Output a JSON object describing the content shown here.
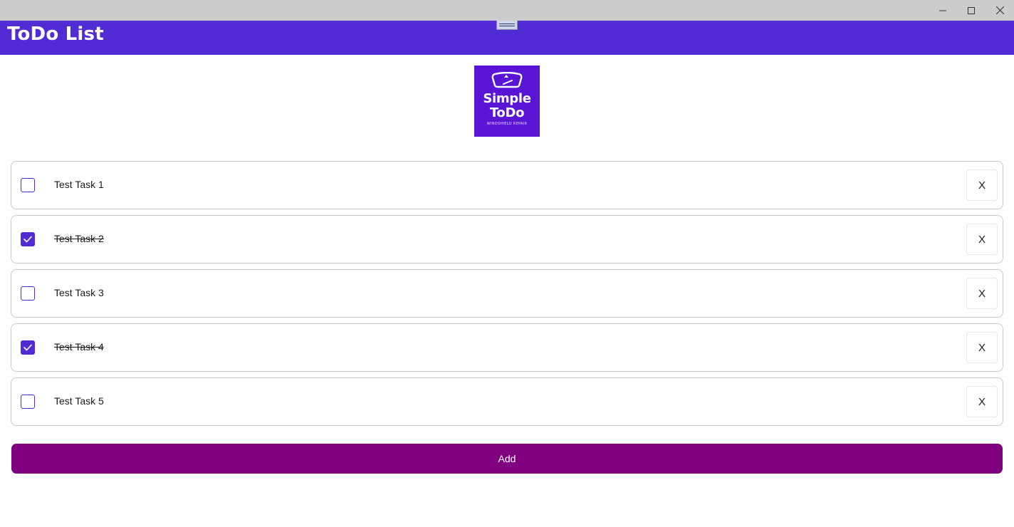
{
  "window": {
    "minimize_icon": "minimize-icon",
    "maximize_icon": "maximize-icon",
    "close_icon": "close-icon"
  },
  "header": {
    "title": "ToDo List",
    "background_color": "#512bd4"
  },
  "logo": {
    "line1": "Simple",
    "line2": "ToDo",
    "subtitle": "WINDSHIELD REPAIR",
    "icon": "windshield-icon",
    "background_color": "#5a14d6"
  },
  "tasks": [
    {
      "label": "Test Task 1",
      "done": false,
      "delete_label": "X"
    },
    {
      "label": "Test Task 2",
      "done": true,
      "delete_label": "X"
    },
    {
      "label": "Test Task 3",
      "done": false,
      "delete_label": "X"
    },
    {
      "label": "Test Task 4",
      "done": true,
      "delete_label": "X"
    },
    {
      "label": "Test Task 5",
      "done": false,
      "delete_label": "X"
    }
  ],
  "add_button": {
    "label": "Add",
    "color": "#800080"
  },
  "accent_color": "#512bd4"
}
